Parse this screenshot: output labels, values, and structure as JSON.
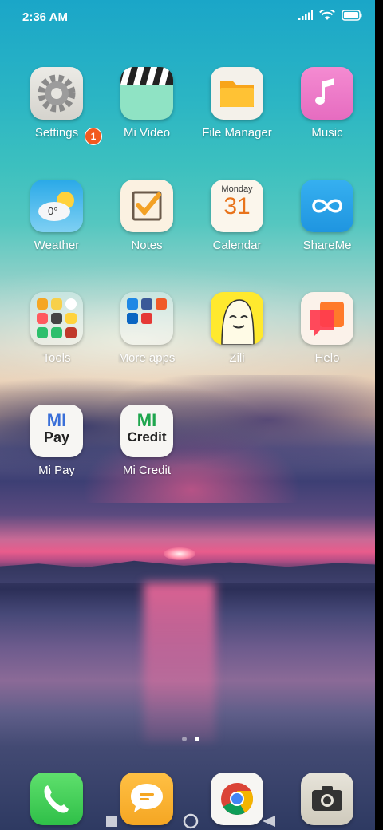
{
  "status": {
    "time": "2:36 AM"
  },
  "notifications": {
    "settings_badge": "1"
  },
  "apps": {
    "settings": "Settings",
    "mi_video": "Mi Video",
    "file_manager": "File Manager",
    "music": "Music",
    "weather": "Weather",
    "weather_temp": "0°",
    "notes": "Notes",
    "calendar": "Calendar",
    "calendar_day": "Monday",
    "calendar_date": "31",
    "shareme": "ShareMe",
    "tools": "Tools",
    "more_apps": "More apps",
    "zili": "Zili",
    "helo": "Helo",
    "mi_pay": "Mi Pay",
    "mi_pay_icon_text": "Pay",
    "mi_credit": "Mi Credit",
    "mi_credit_icon_text": "Credit",
    "mi_logo": "MI"
  },
  "dock": {
    "phone": "phone-icon",
    "messaging": "message-icon",
    "chrome": "chrome-icon",
    "camera": "camera-icon"
  },
  "pages": {
    "count": 2,
    "active": 2
  },
  "colors": {
    "badge": "#f25a1f",
    "accent_green": "#1fa64e",
    "accent_blue": "#3a6fd8"
  }
}
